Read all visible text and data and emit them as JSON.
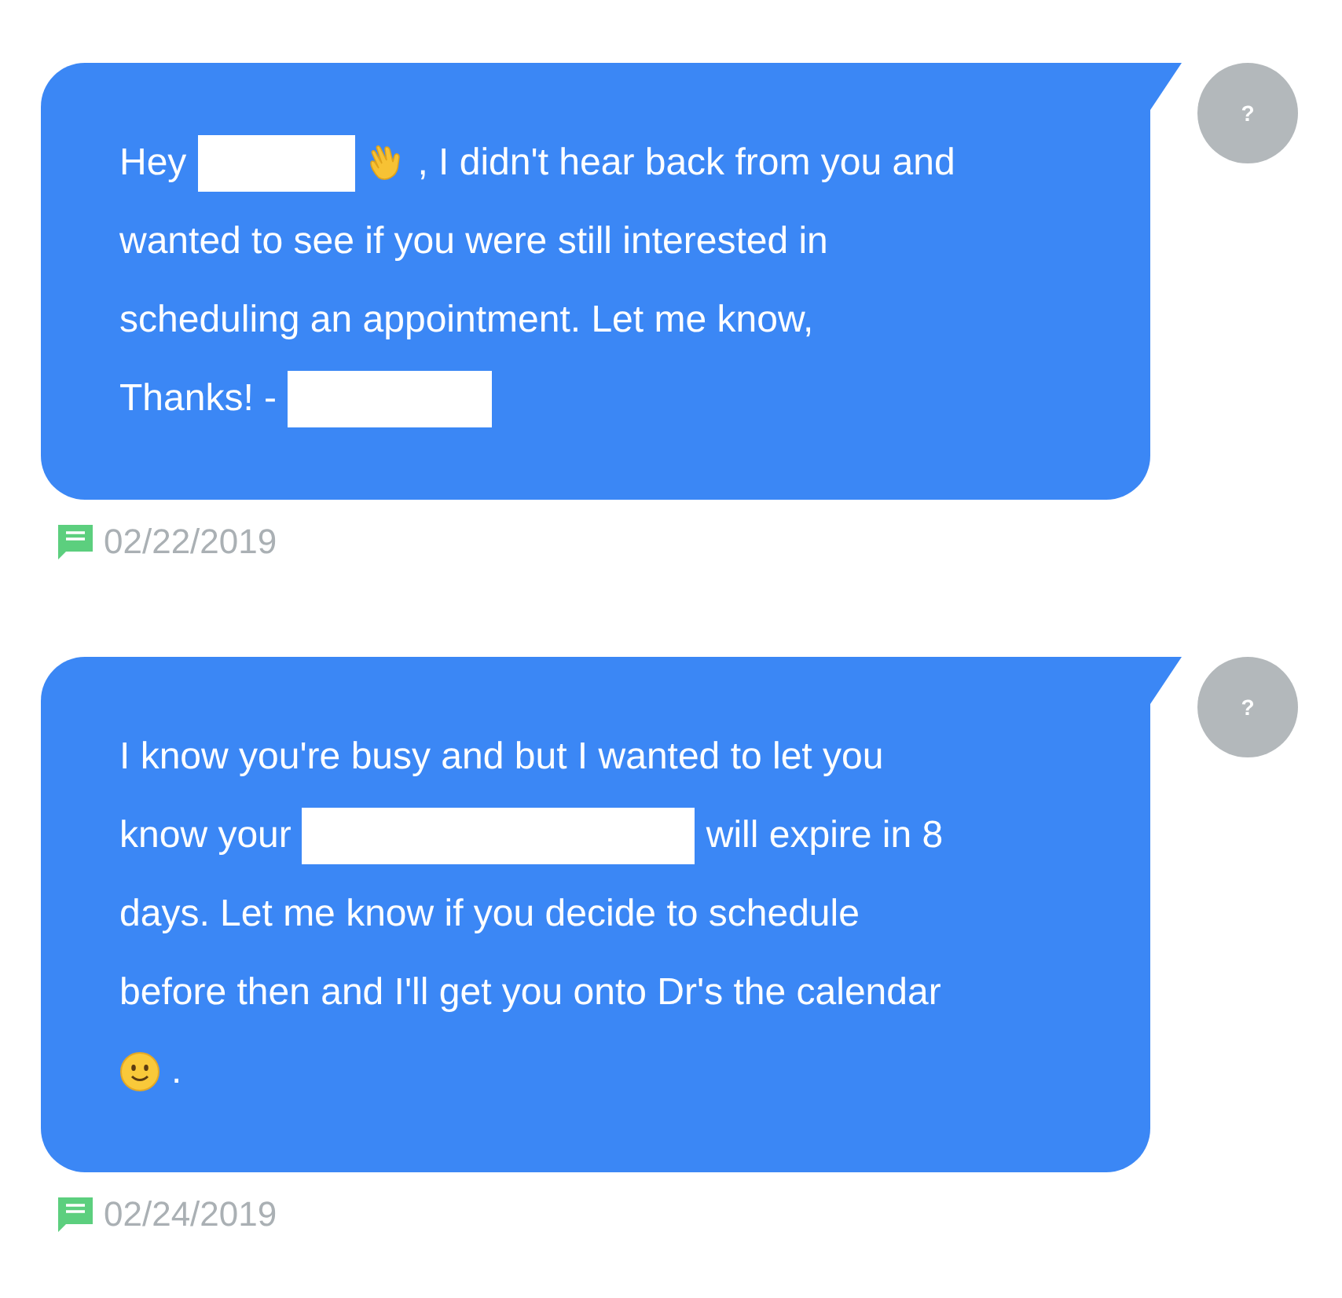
{
  "messages": [
    {
      "lines": [
        [
          {
            "kind": "text",
            "text": "Hey"
          },
          {
            "kind": "redacted"
          },
          {
            "kind": "wave"
          },
          {
            "kind": "text",
            "text": ", I didn't hear back from you and"
          }
        ],
        [
          {
            "kind": "text",
            "text": "wanted to see if you were still interested in"
          }
        ],
        [
          {
            "kind": "text",
            "text": "scheduling an appointment. Let me know,"
          }
        ],
        [
          {
            "kind": "text",
            "text": "Thanks! -"
          },
          {
            "kind": "redacted"
          }
        ]
      ],
      "avatar": "?",
      "date": "02/22/2019"
    },
    {
      "lines": [
        [
          {
            "kind": "text",
            "text": "I know you're busy and but I wanted to let you"
          }
        ],
        [
          {
            "kind": "text",
            "text": "know your"
          },
          {
            "kind": "redacted"
          },
          {
            "kind": "text",
            "text": "will expire in 8"
          }
        ],
        [
          {
            "kind": "text",
            "text": "days. Let me know if you decide to schedule"
          }
        ],
        [
          {
            "kind": "text",
            "text": "before then and I'll get you onto Dr's the calendar"
          }
        ],
        [
          {
            "kind": "smile"
          },
          {
            "kind": "text",
            "text": "."
          }
        ]
      ],
      "avatar": "?",
      "date": "02/24/2019"
    }
  ]
}
